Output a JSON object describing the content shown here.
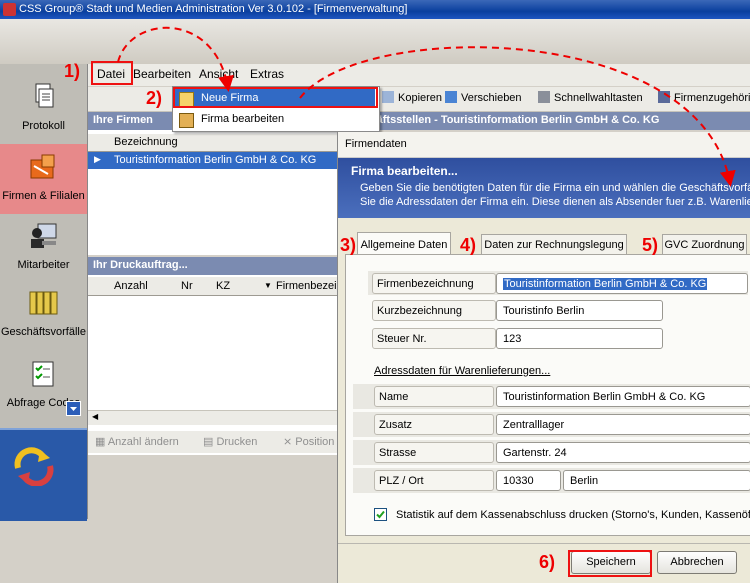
{
  "window": {
    "title": "CSS Group® Stadt und Medien Administration Ver 3.0.102 - [Firmenverwaltung]"
  },
  "nav": {
    "items": [
      {
        "label": "Protokoll"
      },
      {
        "label": "Firmen & Filialen",
        "active": true
      },
      {
        "label": "Mitarbeiter"
      },
      {
        "label": "Geschäftsvorfälle"
      },
      {
        "label": "Abfrage Codes"
      }
    ]
  },
  "menubar": {
    "items": [
      "Datei",
      "Bearbeiten",
      "Ansicht",
      "Extras"
    ]
  },
  "toolbar": {
    "buttons": [
      "Kopieren",
      "Verschieben",
      "Schnellwahltasten",
      "Firmenzugehörig"
    ]
  },
  "file_menu": {
    "items": [
      "Neue Firma",
      "Firma bearbeiten"
    ]
  },
  "firms": {
    "header": "Ihre Firmen",
    "column": "Bezeichnung",
    "rows": [
      "Touristinformation Berlin GmbH & Co. KG"
    ]
  },
  "branches": {
    "header": "Geschäftsstellen  -  Touristinformation Berlin GmbH & Co. KG"
  },
  "print_orders": {
    "header": "Ihr Druckauftrag...",
    "columns": [
      "Anzahl",
      "Nr",
      "KZ",
      "Firmenbezei"
    ],
    "actions": [
      "Anzahl ändern",
      "Drucken",
      "Position"
    ]
  },
  "dialog": {
    "caption": "Firmendaten",
    "heading": "Firma bearbeiten...",
    "description_line1": "Geben Sie die benötigten Daten für die Firma ein und wählen die Geschäftsvorfälle",
    "description_line2": "Sie die Adressdaten der Firma ein. Diese dienen als Absender fuer z.B. Warenlieferun",
    "tabs": [
      "Allgemeine Daten",
      "Daten zur Rechnungslegung",
      "GVC Zuordnung"
    ],
    "fields": {
      "firmenbezeichnung": {
        "label": "Firmenbezeichnung",
        "value": "Touristinformation Berlin GmbH & Co. KG"
      },
      "kurzbezeichnung": {
        "label": "Kurzbezeichnung",
        "value": "Touristinfo Berlin"
      },
      "steuer_nr": {
        "label": "Steuer Nr.",
        "value": "123"
      }
    },
    "address_section": "Adressdaten für Warenlieferungen...",
    "address": {
      "name": {
        "label": "Name",
        "value": "Touristinformation Berlin GmbH & Co. KG"
      },
      "zusatz": {
        "label": "Zusatz",
        "value": "Zentralllager"
      },
      "strasse": {
        "label": "Strasse",
        "value": "Gartenstr. 24"
      },
      "plz_ort": {
        "label": "PLZ / Ort",
        "plz": "10330",
        "ort": "Berlin"
      }
    },
    "checkbox_label": "Statistik auf dem Kassenabschluss drucken (Storno's, Kunden, Kassenöffnu",
    "checkbox_checked": true,
    "save_label": "Speichern",
    "cancel_label": "Abbrechen"
  },
  "annotations": [
    "1)",
    "2)",
    "3)",
    "4)",
    "5)",
    "6)"
  ],
  "colors": {
    "annotation": "#e00000",
    "selection": "#316ac5",
    "active_nav": "#e7898a"
  }
}
